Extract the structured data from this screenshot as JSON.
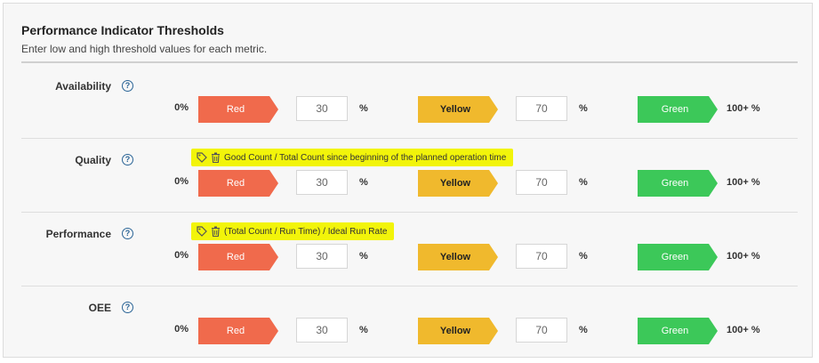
{
  "panel": {
    "title": "Performance Indicator Thresholds",
    "subtitle": "Enter low and high threshold values for each metric."
  },
  "colors": {
    "red": "#f06a4c",
    "yellow": "#f0b92d",
    "green": "#3cc859",
    "highlight": "#f2f40a"
  },
  "icons": {
    "help": "question-circle-icon",
    "tag": "tag-icon",
    "delete": "trash-icon"
  },
  "metrics": [
    {
      "label": "Availability",
      "help": "?",
      "formula": "",
      "start": "0%",
      "red": "Red",
      "low": "30",
      "unit": "%",
      "yellow": "Yellow",
      "high": "70",
      "green": "Green",
      "end": "100+ %"
    },
    {
      "label": "Quality",
      "help": "?",
      "formula": "Good Count / Total Count since beginning of the planned operation time",
      "start": "0%",
      "red": "Red",
      "low": "30",
      "unit": "%",
      "yellow": "Yellow",
      "high": "70",
      "green": "Green",
      "end": "100+ %"
    },
    {
      "label": "Performance",
      "help": "?",
      "formula": "(Total Count / Run Time) / Ideal Run Rate",
      "start": "0%",
      "red": "Red",
      "low": "30",
      "unit": "%",
      "yellow": "Yellow",
      "high": "70",
      "green": "Green",
      "end": "100+ %"
    },
    {
      "label": "OEE",
      "help": "?",
      "formula": "",
      "start": "0%",
      "red": "Red",
      "low": "30",
      "unit": "%",
      "yellow": "Yellow",
      "high": "70",
      "green": "Green",
      "end": "100+ %"
    }
  ]
}
